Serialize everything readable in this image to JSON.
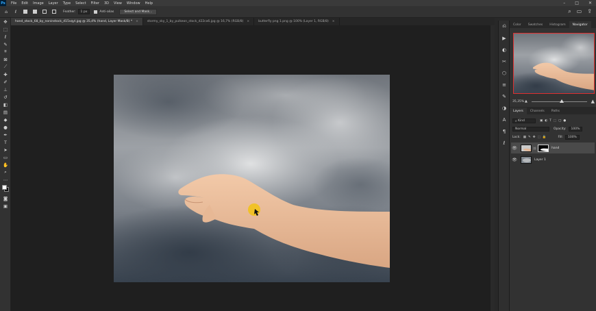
{
  "menubar": {
    "logo": "Ps",
    "items": [
      "File",
      "Edit",
      "Image",
      "Layer",
      "Type",
      "Select",
      "Filter",
      "3D",
      "View",
      "Window",
      "Help"
    ],
    "window_controls": [
      "–",
      "□",
      "✕"
    ]
  },
  "options_bar": {
    "feather_label": "Feather:",
    "feather_value": "1 px",
    "antialias_label": "Anti-alias",
    "select_mask_button": "Select and Mask..."
  },
  "tabs": [
    {
      "label": "hand_stock_68_by_noninstock_d15vqyl.jpg @ 35,4% (hand, Layer Mask/8) *",
      "active": true
    },
    {
      "label": "stormy_sky_1_by_pulkeon_stock_d22ca6.jpg @ 16,7% (RGB/8)",
      "active": false
    },
    {
      "label": "butterfly png 1.png @ 100% (Layer 1, RGB/8)",
      "active": false
    }
  ],
  "navigator_panel": {
    "tabs": [
      "Color",
      "Swatches",
      "Histogram",
      "Navigator"
    ],
    "active_tab": "Navigator",
    "zoom_label": "35,35%",
    "zoom_fraction": 0.55
  },
  "layers_panel": {
    "tabs": [
      "Layers",
      "Channels",
      "Paths"
    ],
    "active_tab": "Layers",
    "filter_label": "Kind",
    "blend_mode": "Normal",
    "opacity_label": "Opacity:",
    "opacity_value": "100%",
    "lock_label": "Lock:",
    "fill_label": "Fill:",
    "fill_value": "100%",
    "layers": [
      {
        "name": "hand",
        "selected": true,
        "has_mask": true
      },
      {
        "name": "Layer 1",
        "selected": false,
        "has_mask": false
      }
    ]
  },
  "colors": {
    "accent": "#31a8ff",
    "navigator_view_box": "#e03030",
    "cursor_highlight": "#f2c21b"
  },
  "icons": {
    "tools": [
      "move-icon",
      "marquee-icon",
      "lasso-icon",
      "quick-select-icon",
      "crop-icon",
      "frame-icon",
      "eyedropper-icon",
      "healing-icon",
      "brush-icon",
      "stamp-icon",
      "history-brush-icon",
      "eraser-icon",
      "gradient-icon",
      "blur-icon",
      "dodge-icon",
      "pen-icon",
      "type-icon",
      "path-select-icon",
      "shape-icon",
      "hand-icon",
      "zoom-icon",
      "more-icon"
    ]
  }
}
